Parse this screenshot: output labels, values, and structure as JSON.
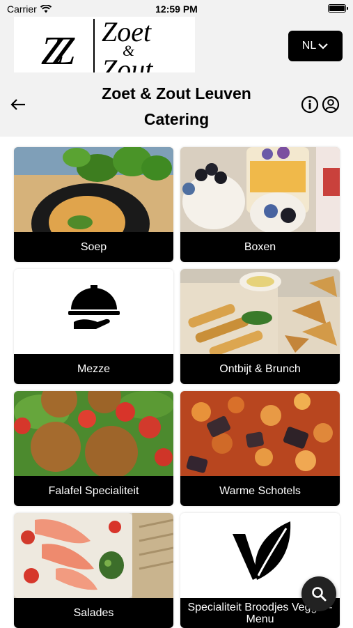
{
  "status_bar": {
    "carrier": "Carrier",
    "time": "12:59 PM"
  },
  "logo": {
    "monogram": "ZZ",
    "word_top": "Zoet",
    "word_amp": "&",
    "word_bottom": "Zout"
  },
  "language": {
    "label": "NL"
  },
  "header": {
    "title_line1": "Zoet & Zout Leuven",
    "title_line2": "Catering"
  },
  "categories": [
    {
      "label": "Soep"
    },
    {
      "label": "Boxen"
    },
    {
      "label": "Mezze"
    },
    {
      "label": "Ontbijt & Brunch"
    },
    {
      "label": "Falafel Specialiteit"
    },
    {
      "label": "Warme Schotels"
    },
    {
      "label": "Salades"
    },
    {
      "label": "Specialiteit Broodjes Veggie - Menu"
    }
  ],
  "colors": {
    "background": "#ffffff",
    "header_bg": "#f2f2f2",
    "label_bg": "#000000",
    "fab_bg": "#222222"
  }
}
